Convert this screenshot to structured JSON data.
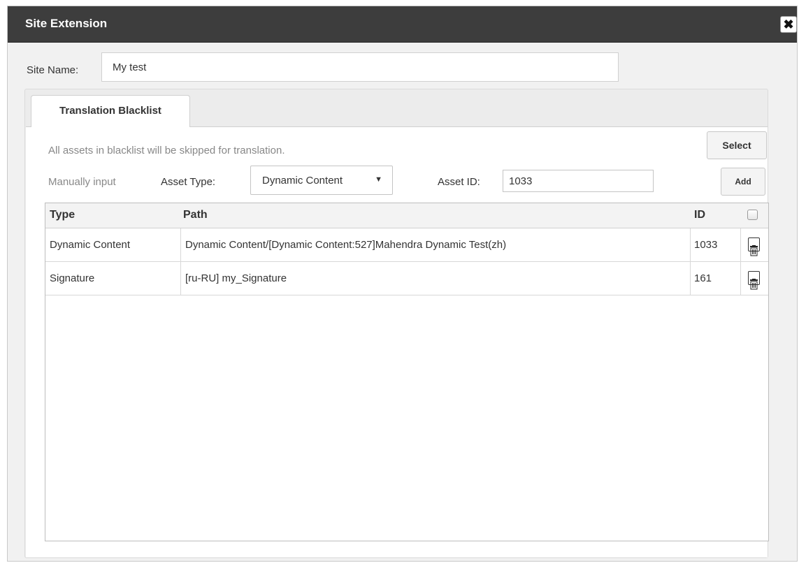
{
  "dialog": {
    "title": "Site Extension",
    "close_icon": "close-icon",
    "close_glyph": "✖"
  },
  "site_name": {
    "label": "Site Name:",
    "value": "My test"
  },
  "tabs": [
    {
      "label": "Translation Blacklist",
      "active": true
    }
  ],
  "blacklist": {
    "note": "All assets in blacklist will be skipped for translation.",
    "select_label": "Select",
    "manual_label": "Manually input",
    "asset_type_label": "Asset Type:",
    "asset_type_value": "Dynamic Content",
    "dropdown_icon": "caret-down-icon",
    "dropdown_glyph": "▼",
    "asset_id_label": "Asset ID:",
    "asset_id_value": "1033",
    "add_label": "Add"
  },
  "table": {
    "columns": [
      "Type",
      "Path",
      "ID"
    ],
    "select_all_checked": false,
    "rows": [
      {
        "type": "Dynamic Content",
        "path": "Dynamic Content/[Dynamic Content:527]Mahendra Dynamic Test(zh)",
        "id": "1033",
        "action_icon": "trash-icon"
      },
      {
        "type": "Signature",
        "path": "[ru-RU] my_Signature",
        "id": "161",
        "action_icon": "trash-icon"
      }
    ]
  },
  "colors": {
    "titlebar": "#3d3d3d",
    "panel": "#ececec",
    "muted_text": "#888888"
  }
}
